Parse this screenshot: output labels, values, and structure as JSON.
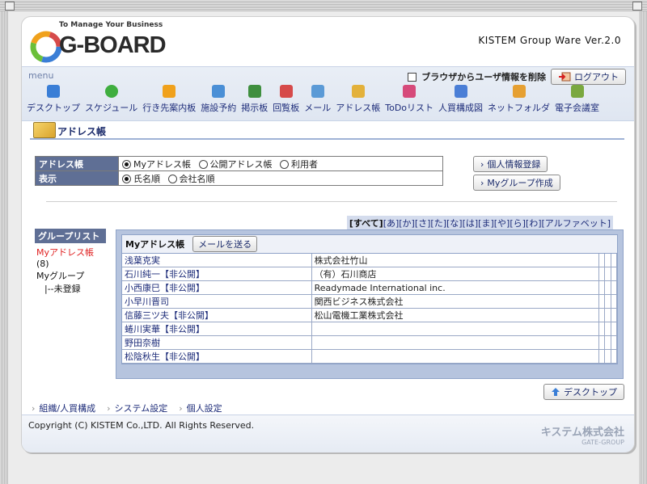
{
  "logo": {
    "tagline": "To Manage Your Business",
    "name": "G-BOARD"
  },
  "version": "KISTEM Group Ware Ver.2.0",
  "menu": {
    "label": "menu",
    "delete_browser_info": "ブラウザからユーザ情報を削除",
    "logout": "ログアウト",
    "items": [
      {
        "label": "デスクトップ",
        "icon": "desktop-icon",
        "color": "#3a7ed6"
      },
      {
        "label": "スケジュール",
        "icon": "clock-icon",
        "color": "#3fae3f"
      },
      {
        "label": "行き先案内板",
        "icon": "arrow-icon",
        "color": "#f0a11c"
      },
      {
        "label": "施設予約",
        "icon": "building-icon",
        "color": "#4a8fd6"
      },
      {
        "label": "掲示板",
        "icon": "board-icon",
        "color": "#3f8f3f"
      },
      {
        "label": "回覧板",
        "icon": "check-icon",
        "color": "#d64a4a"
      },
      {
        "label": "メール",
        "icon": "mail-icon",
        "color": "#5b9ad6"
      },
      {
        "label": "アドレス帳",
        "icon": "book-icon",
        "color": "#e3b13b"
      },
      {
        "label": "ToDoリスト",
        "icon": "todo-icon",
        "color": "#d64a7a"
      },
      {
        "label": "人買構成図",
        "icon": "org-icon",
        "color": "#4a7ed6"
      },
      {
        "label": "ネットフォルダ",
        "icon": "folder-icon",
        "color": "#e6a032"
      },
      {
        "label": "電子会議室",
        "icon": "meeting-icon",
        "color": "#7aa83f"
      }
    ]
  },
  "section_title": "アドレス帳",
  "settings": {
    "row1_label": "アドレス帳",
    "row1_options": [
      "Myアドレス帳",
      "公開アドレス帳",
      "利用者"
    ],
    "row2_label": "表示",
    "row2_options": [
      "氏名順",
      "会社名順"
    ]
  },
  "side_buttons": {
    "register": "個人情報登録",
    "my_group": "Myグループ作成"
  },
  "grouplist": {
    "header": "グループリスト",
    "my_address": "Myアドレス帳",
    "my_address_count": "(8)",
    "my_group": "Myグループ",
    "unregistered": "|--未登録"
  },
  "alpha_bar": {
    "all": "[すべて]",
    "rest": "[あ][か][さ][た][な][は][ま][や][ら][わ][アルファベット]"
  },
  "addr": {
    "title": "Myアドレス帳",
    "send_mail": "メールを送る",
    "rows": [
      {
        "name": "浅葉克実",
        "company": "株式会社竹山"
      },
      {
        "name": "石川純一【非公開】",
        "company": "（有）石川商店"
      },
      {
        "name": "小西康巳【非公開】",
        "company": "Readymade International inc."
      },
      {
        "name": "小早川晋司",
        "company": "関西ビジネス株式会社"
      },
      {
        "name": "信藤三ツ夫【非公開】",
        "company": "松山電機工業株式会社"
      },
      {
        "name": "蜷川実華【非公開】",
        "company": ""
      },
      {
        "name": "野田奈樹",
        "company": ""
      },
      {
        "name": "松陰秋生【非公開】",
        "company": ""
      }
    ]
  },
  "desktop_button": "デスクトップ",
  "bottom_links": [
    "組織/人買構成",
    "システム設定",
    "個人設定"
  ],
  "copyright": "Copyright (C) KISTEM Co.,LTD. All Rights Reserved.",
  "brand": {
    "name": "キステム株式会社",
    "group": "GATE-GROUP"
  }
}
